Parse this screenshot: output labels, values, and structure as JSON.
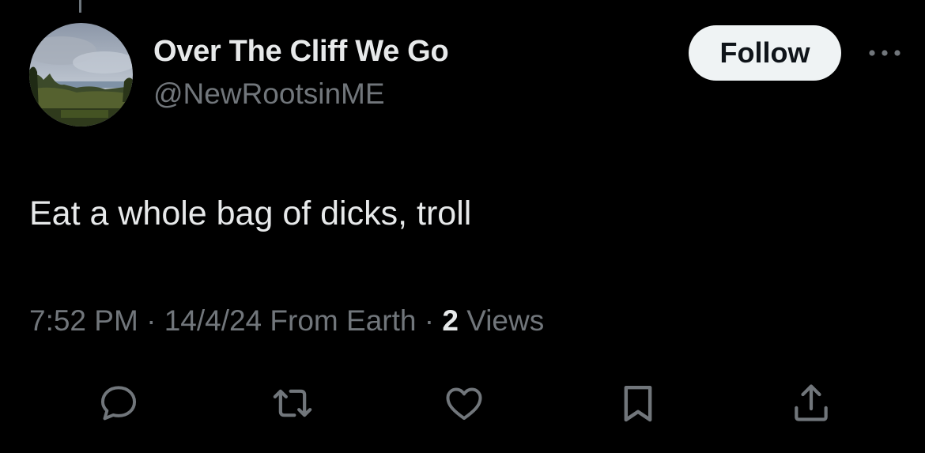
{
  "author": {
    "display_name": "Over The Cliff We Go",
    "handle": "@NewRootsinME"
  },
  "follow_label": "Follow",
  "tweet": {
    "text": "Eat a whole bag of dicks, troll"
  },
  "meta": {
    "time": "7:52 PM",
    "separator1": " · ",
    "date_source": "14/4/24 From Earth",
    "separator2": " · ",
    "views_count": "2",
    "views_label": " Views"
  },
  "actions": [
    "reply-icon",
    "retweet-icon",
    "like-icon",
    "bookmark-icon",
    "share-icon"
  ],
  "colors": {
    "background": "#000000",
    "primary_text": "#e7e9ea",
    "secondary_text": "#71767b",
    "follow_bg": "#eff3f4",
    "follow_text": "#0f1419"
  }
}
